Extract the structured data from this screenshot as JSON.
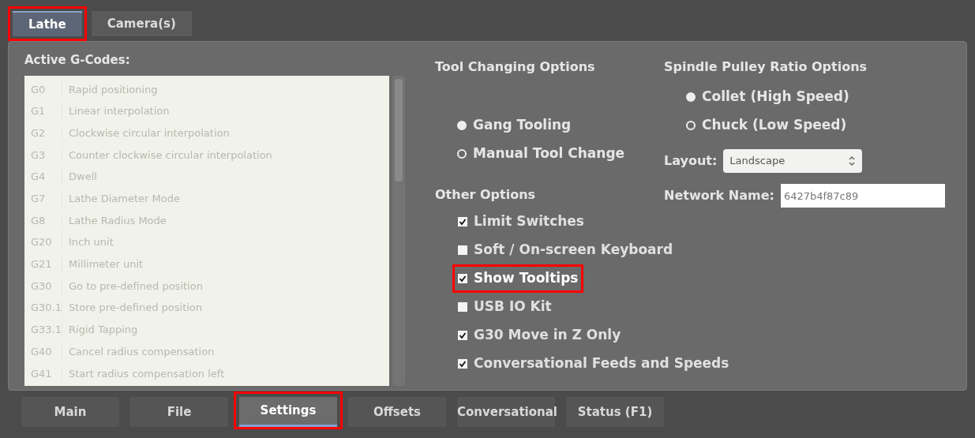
{
  "top_tabs": [
    {
      "label": "Lathe",
      "selected": true,
      "highlighted": true
    },
    {
      "label": "Camera(s)",
      "selected": false,
      "highlighted": false
    }
  ],
  "gcodes": {
    "title": "Active G-Codes:",
    "rows": [
      {
        "code": "G0",
        "description": "Rapid positioning"
      },
      {
        "code": "G1",
        "description": "Linear interpolation"
      },
      {
        "code": "G2",
        "description": "Clockwise circular interpolation"
      },
      {
        "code": "G3",
        "description": "Counter clockwise circular interpolation"
      },
      {
        "code": "G4",
        "description": "Dwell"
      },
      {
        "code": "G7",
        "description": "Lathe Diameter Mode"
      },
      {
        "code": "G8",
        "description": "Lathe Radius Mode"
      },
      {
        "code": "G20",
        "description": "Inch unit"
      },
      {
        "code": "G21",
        "description": "Millimeter unit"
      },
      {
        "code": "G30",
        "description": "Go to pre-defined position"
      },
      {
        "code": "G30.1",
        "description": "Store pre-defined position"
      },
      {
        "code": "G33.1",
        "description": "Rigid Tapping"
      },
      {
        "code": "G40",
        "description": "Cancel radius compensation"
      },
      {
        "code": "G41",
        "description": "Start radius compensation left"
      }
    ]
  },
  "tool_changing": {
    "title": "Tool Changing Options",
    "options": [
      {
        "label": "Gang Tooling",
        "selected": true
      },
      {
        "label": "Manual Tool Change",
        "selected": false
      }
    ]
  },
  "spindle_pulley": {
    "title": "Spindle Pulley Ratio Options",
    "options": [
      {
        "label": "Collet (High Speed)",
        "selected": true
      },
      {
        "label": "Chuck (Low Speed)",
        "selected": false
      }
    ]
  },
  "layout": {
    "label": "Layout:",
    "value": "Landscape"
  },
  "network_name": {
    "label": "Network Name:",
    "value": "6427b4f87c89"
  },
  "other_options": {
    "title": "Other Options",
    "items": [
      {
        "label": "Limit Switches",
        "checked": true,
        "highlighted": false
      },
      {
        "label": "Soft / On-screen Keyboard",
        "checked": false,
        "highlighted": false
      },
      {
        "label": "Show Tooltips",
        "checked": true,
        "highlighted": true
      },
      {
        "label": "USB IO Kit",
        "checked": false,
        "highlighted": false
      },
      {
        "label": "G30 Move in Z Only",
        "checked": true,
        "highlighted": false
      },
      {
        "label": "Conversational Feeds and Speeds",
        "checked": true,
        "highlighted": false
      }
    ]
  },
  "bottom_tabs": [
    {
      "label": "Main",
      "selected": false,
      "highlighted": false
    },
    {
      "label": "File",
      "selected": false,
      "highlighted": false
    },
    {
      "label": "Settings",
      "selected": true,
      "highlighted": true
    },
    {
      "label": "Offsets",
      "selected": false,
      "highlighted": false
    },
    {
      "label": "Conversational",
      "selected": false,
      "highlighted": false
    },
    {
      "label": "Status (F1)",
      "selected": false,
      "highlighted": false
    }
  ]
}
